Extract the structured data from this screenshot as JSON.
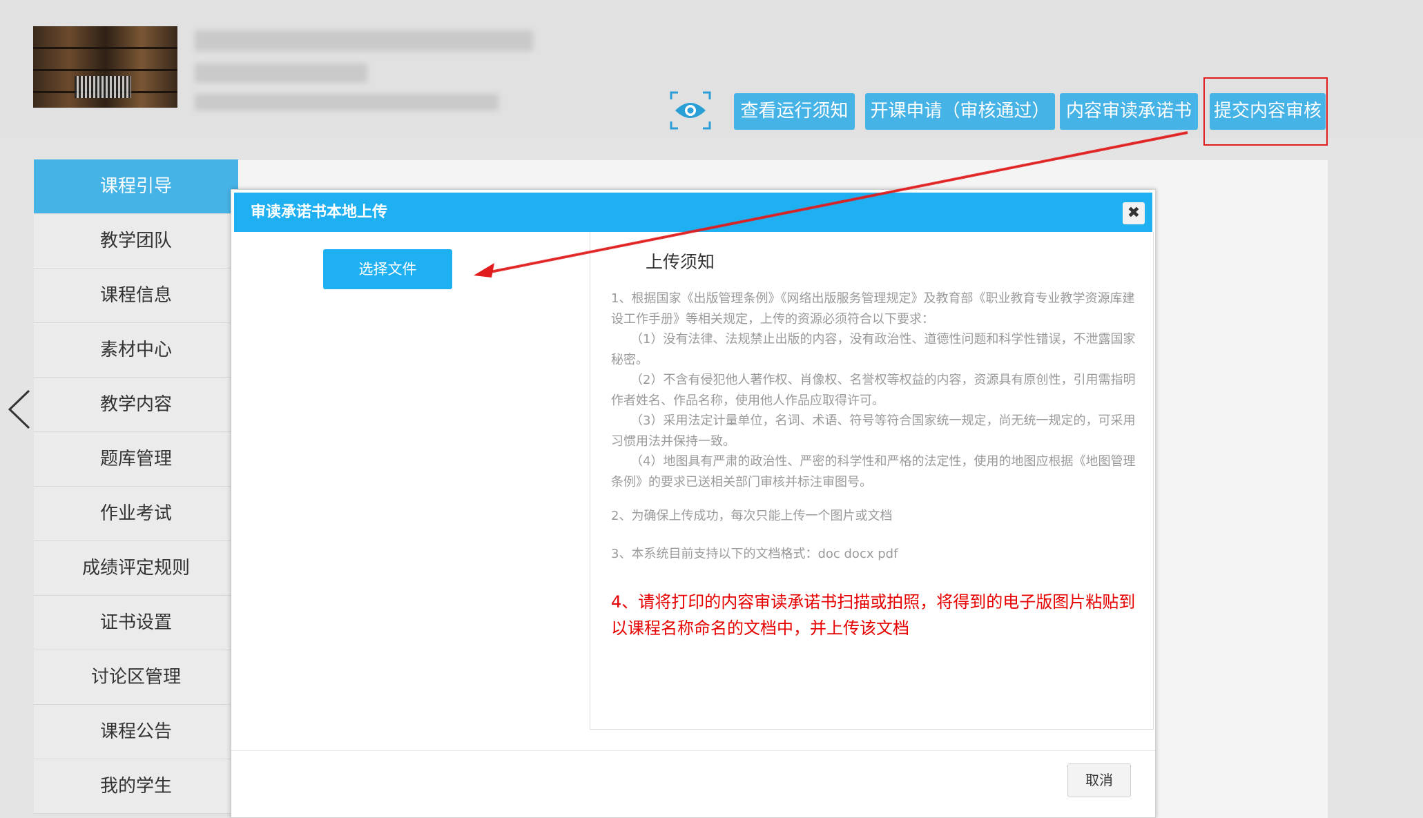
{
  "toolbar": {
    "buttons": [
      "查看运行须知",
      "开课申请（审核通过）",
      "内容审读承诺书",
      "提交内容审核"
    ]
  },
  "sidebar": {
    "items": [
      "课程引导",
      "教学团队",
      "课程信息",
      "素材中心",
      "教学内容",
      "题库管理",
      "作业考试",
      "成绩评定规则",
      "证书设置",
      "讨论区管理",
      "课程公告",
      "我的学生"
    ]
  },
  "modal": {
    "title": "审读承诺书本地上传",
    "close_symbol": "✖",
    "choose_file": "选择文件",
    "notice_title": "上传须知",
    "notice_p1": "1、根据国家《出版管理条例》《网络出版服务管理规定》及教育部《职业教育专业教学资源库建设工作手册》等相关规定，上传的资源必须符合以下要求：",
    "notice_p1_1": "（1）没有法律、法规禁止出版的内容，没有政治性、道德性问题和科学性错误，不泄露国家秘密。",
    "notice_p1_2": "（2）不含有侵犯他人著作权、肖像权、名誉权等权益的内容，资源具有原创性，引用需指明作者姓名、作品名称，使用他人作品应取得许可。",
    "notice_p1_3": "（3）采用法定计量单位，名词、术语、符号等符合国家统一规定，尚无统一规定的，可采用习惯用法并保持一致。",
    "notice_p1_4": "（4）地图具有严肃的政治性、严密的科学性和严格的法定性，使用的地图应根据《地图管理条例》的要求已送相关部门审核并标注审图号。",
    "notice_p2": "2、为确保上传成功，每次只能上传一个图片或文档",
    "notice_p3": "3、本系统目前支持以下的文档格式：doc docx pdf",
    "notice_p4": "4、请将打印的内容审读承诺书扫描或拍照，将得到的电子版图片粘贴到以课程名称命名的文档中，并上传该文档",
    "cancel": "取消"
  },
  "colors": {
    "primary": "#1fb0f2",
    "toolbar_button": "#46b3e6",
    "annotation_red": "#e11c1c",
    "notice_red": "#e60000"
  }
}
